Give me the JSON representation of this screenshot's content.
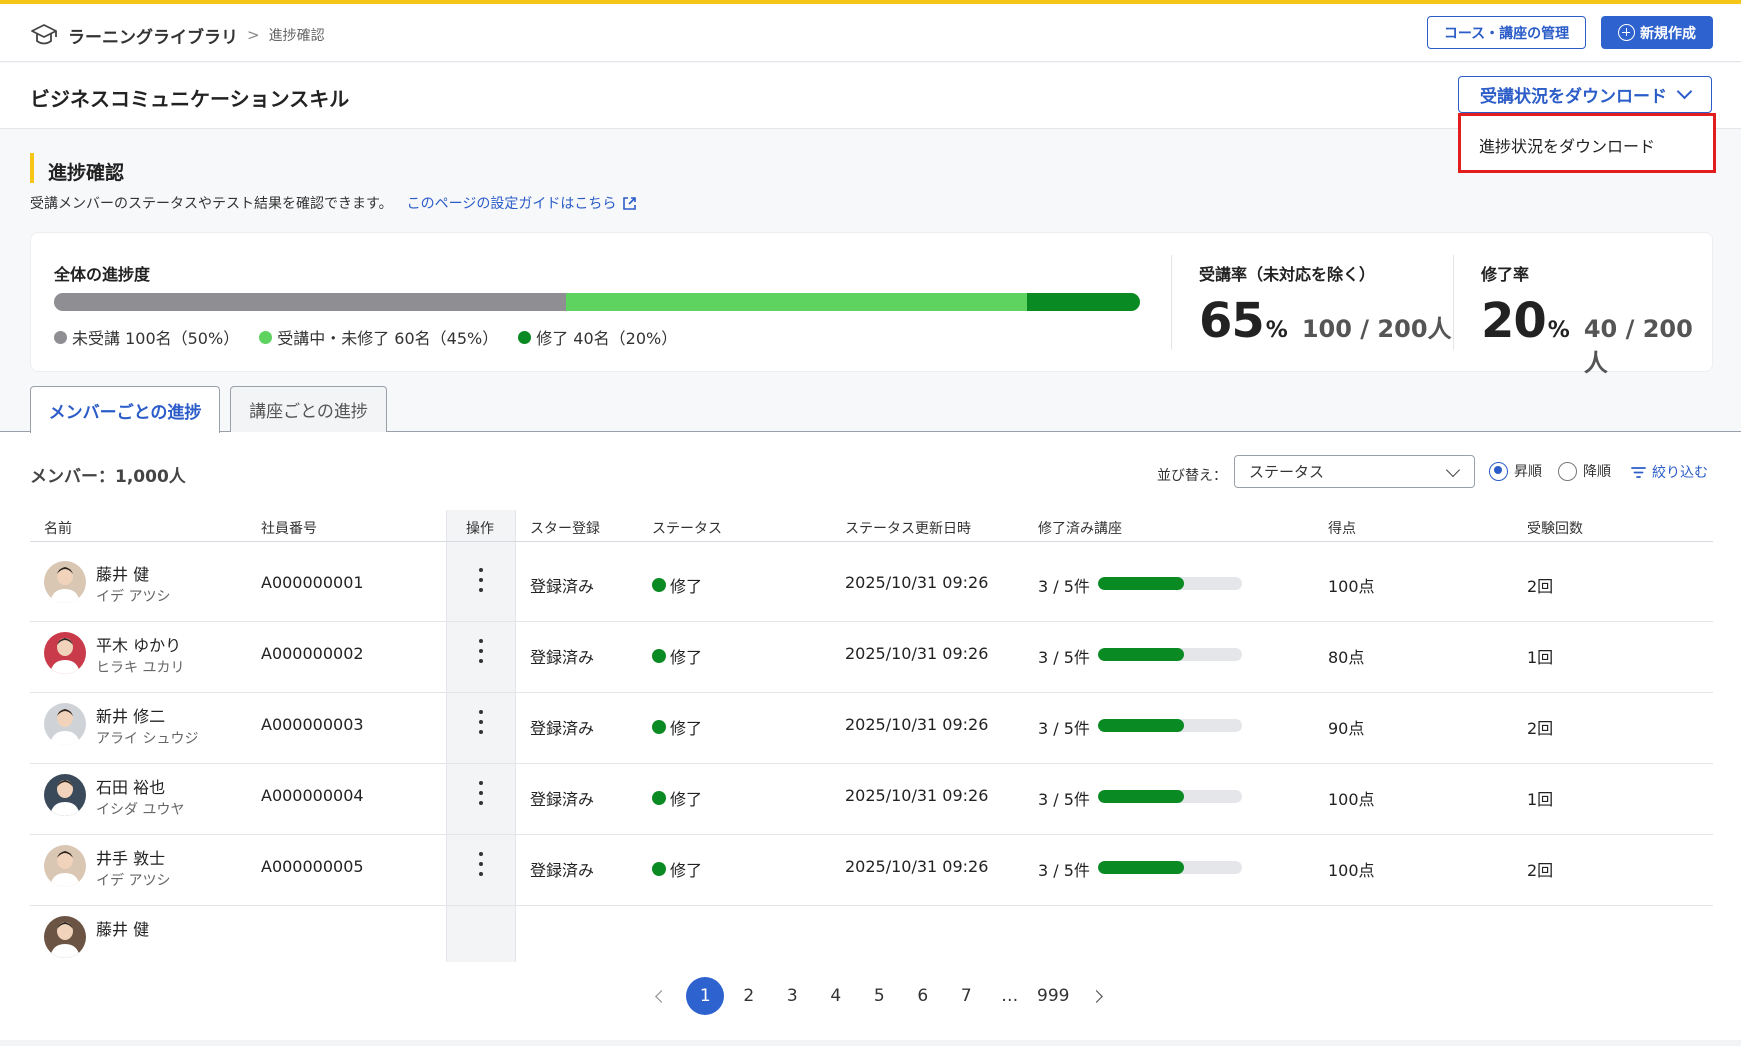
{
  "header": {
    "breadcrumb_root": "ラーニングライブラリ",
    "breadcrumb_sep": ">",
    "breadcrumb_current": "進捗確認",
    "manage_button": "コース・講座の管理",
    "new_button": "新規作成"
  },
  "title": {
    "page_title": "ビジネスコミュニケーションスキル",
    "download_button": "受講状況をダウンロード",
    "download_menu_item": "進捗状況をダウンロード"
  },
  "section": {
    "title": "進捗確認",
    "description": "受講メンバーのステータスやテスト結果を確認できます。",
    "guide_link": "このページの設定ガイドはこちら"
  },
  "summary": {
    "overall_label": "全体の進捗度",
    "progress": [
      {
        "label": "未受講 100名（50%）",
        "percent": 50,
        "color": "#8e8e93"
      },
      {
        "label": "受講中・未修了 60名（45%）",
        "percent": 45,
        "color": "#5fd35f"
      },
      {
        "label": "修了 40名（20%）",
        "percent": 11,
        "color": "#0a8a22"
      }
    ],
    "rate_label": "受講率（未対応を除く）",
    "rate_value": "65",
    "rate_pct": "%",
    "rate_fraction": "100 / 200人",
    "done_label": "修了率",
    "done_value": "20",
    "done_pct": "%",
    "done_fraction": "40 / 200人"
  },
  "tabs": {
    "members": "メンバーごとの進捗",
    "courses": "講座ごとの進捗"
  },
  "toolbar": {
    "member_count": "メンバー：1,000人",
    "sort_label": "並び替え：",
    "sort_value": "ステータス",
    "asc": "昇順",
    "desc": "降順",
    "filter": "絞り込む"
  },
  "table": {
    "headers": [
      "名前",
      "社員番号",
      "操作",
      "スター登録",
      "ステータス",
      "ステータス更新日時",
      "修了済み講座",
      "得点",
      "受験回数"
    ],
    "rows": [
      {
        "name": "藤井 健",
        "kana": "イデ アツシ",
        "id": "A000000001",
        "star": "登録済み",
        "status": "修了",
        "updated": "2025/10/31 09:26",
        "courses": "3 / 5件",
        "course_ratio": 0.6,
        "score": "100点",
        "attempts": "2回",
        "avatar_bg": "#d9c7b4"
      },
      {
        "name": "平木 ゆかり",
        "kana": "ヒラキ ユカリ",
        "id": "A000000002",
        "star": "登録済み",
        "status": "修了",
        "updated": "2025/10/31 09:26",
        "courses": "3 / 5件",
        "course_ratio": 0.6,
        "score": "80点",
        "attempts": "1回",
        "avatar_bg": "#c93a4a"
      },
      {
        "name": "新井 修二",
        "kana": "アライ シュウジ",
        "id": "A000000003",
        "star": "登録済み",
        "status": "修了",
        "updated": "2025/10/31 09:26",
        "courses": "3 / 5件",
        "course_ratio": 0.6,
        "score": "90点",
        "attempts": "2回",
        "avatar_bg": "#cfd3d8"
      },
      {
        "name": "石田 裕也",
        "kana": "イシダ ユウヤ",
        "id": "A000000004",
        "star": "登録済み",
        "status": "修了",
        "updated": "2025/10/31 09:26",
        "courses": "3 / 5件",
        "course_ratio": 0.6,
        "score": "100点",
        "attempts": "1回",
        "avatar_bg": "#3b4a5a"
      },
      {
        "name": "井手 敦士",
        "kana": "イデ アツシ",
        "id": "A000000005",
        "star": "登録済み",
        "status": "修了",
        "updated": "2025/10/31 09:26",
        "courses": "3 / 5件",
        "course_ratio": 0.6,
        "score": "100点",
        "attempts": "2回",
        "avatar_bg": "#d9c7b4"
      },
      {
        "name": "藤井 健",
        "kana": "",
        "id": "",
        "star": "",
        "status": "",
        "updated": "",
        "courses": "",
        "course_ratio": 0,
        "score": "",
        "attempts": "",
        "avatar_bg": "#6b5444"
      }
    ]
  },
  "pagination": {
    "pages": [
      "1",
      "2",
      "3",
      "4",
      "5",
      "6",
      "7",
      "…",
      "999"
    ],
    "current": "1"
  }
}
